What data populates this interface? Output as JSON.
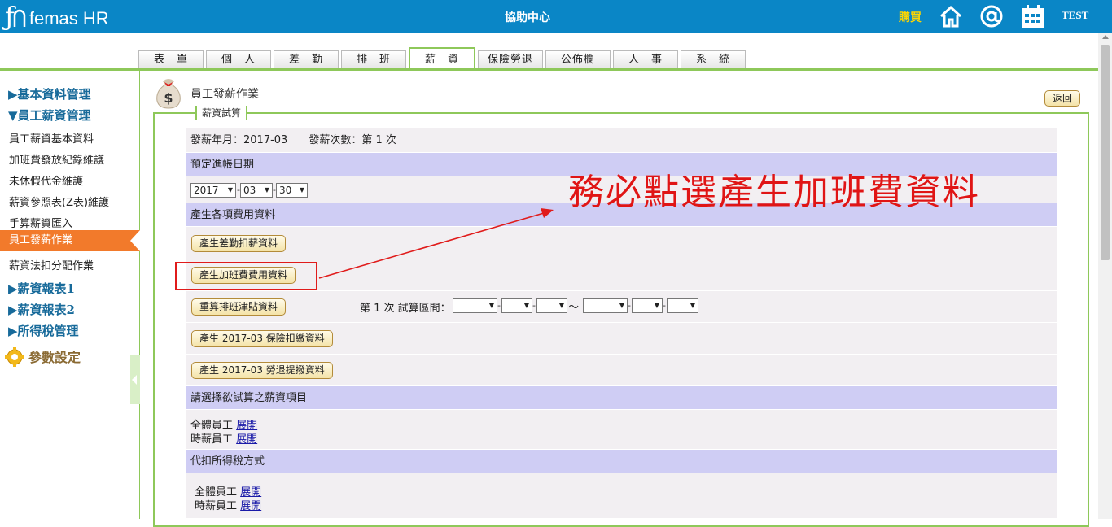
{
  "header": {
    "logo_text": "femas HR",
    "center_title": "協助中心",
    "buy_label": "購買",
    "user_label": "TEST"
  },
  "tabs": [
    {
      "label": "表　單"
    },
    {
      "label": "個　人"
    },
    {
      "label": "差　勤"
    },
    {
      "label": "排　班"
    },
    {
      "label": "薪　資",
      "active": true
    },
    {
      "label": "保險勞退"
    },
    {
      "label": "公佈欄"
    },
    {
      "label": "人　事"
    },
    {
      "label": "系　統"
    }
  ],
  "sidebar": {
    "sections": [
      {
        "label": "▶基本資料管理"
      },
      {
        "label": "▼員工薪資管理"
      },
      {
        "label": "▶薪資報表1"
      },
      {
        "label": "▶薪資報表2"
      },
      {
        "label": "▶所得稅管理"
      }
    ],
    "items": [
      {
        "label": "員工薪資基本資料"
      },
      {
        "label": "加班費發放紀錄維護"
      },
      {
        "label": "未休假代金維護"
      },
      {
        "label": "薪資參照表(Z表)維護"
      },
      {
        "label": "手算薪資匯入"
      },
      {
        "label": "員工發薪作業",
        "active": true
      },
      {
        "label": "薪資法扣分配作業"
      }
    ],
    "param_label": "參數設定"
  },
  "page": {
    "title": "員工發薪作業",
    "back_label": "返回",
    "legend": "薪資試算",
    "period_label": "發薪年月：2017-03　　發薪次數：第 1 次",
    "preset_date_header": "預定進帳日期",
    "year": "2017",
    "month": "03",
    "day": "30",
    "gen_header": "產生各項費用資料",
    "btn_attendance": "產生差勤扣薪資料",
    "btn_overtime": "產生加班費費用資料",
    "btn_recalc": "重算排班津貼資料",
    "range_label": "第 1 次 試算區間：",
    "range_sep": "～",
    "btn_insurance": "產生 2017-03 保險扣繳資料",
    "btn_pension": "產生 2017-03 勞退提撥資料",
    "items_header": "請選擇欲試算之薪資項目",
    "all_emp": "全體員工",
    "hourly_emp": "時薪員工",
    "expand": "展開",
    "tax_header": "代扣所得稅方式"
  },
  "annotation": {
    "text": "務必點選產生加班費資料",
    "color": "#e01515"
  }
}
